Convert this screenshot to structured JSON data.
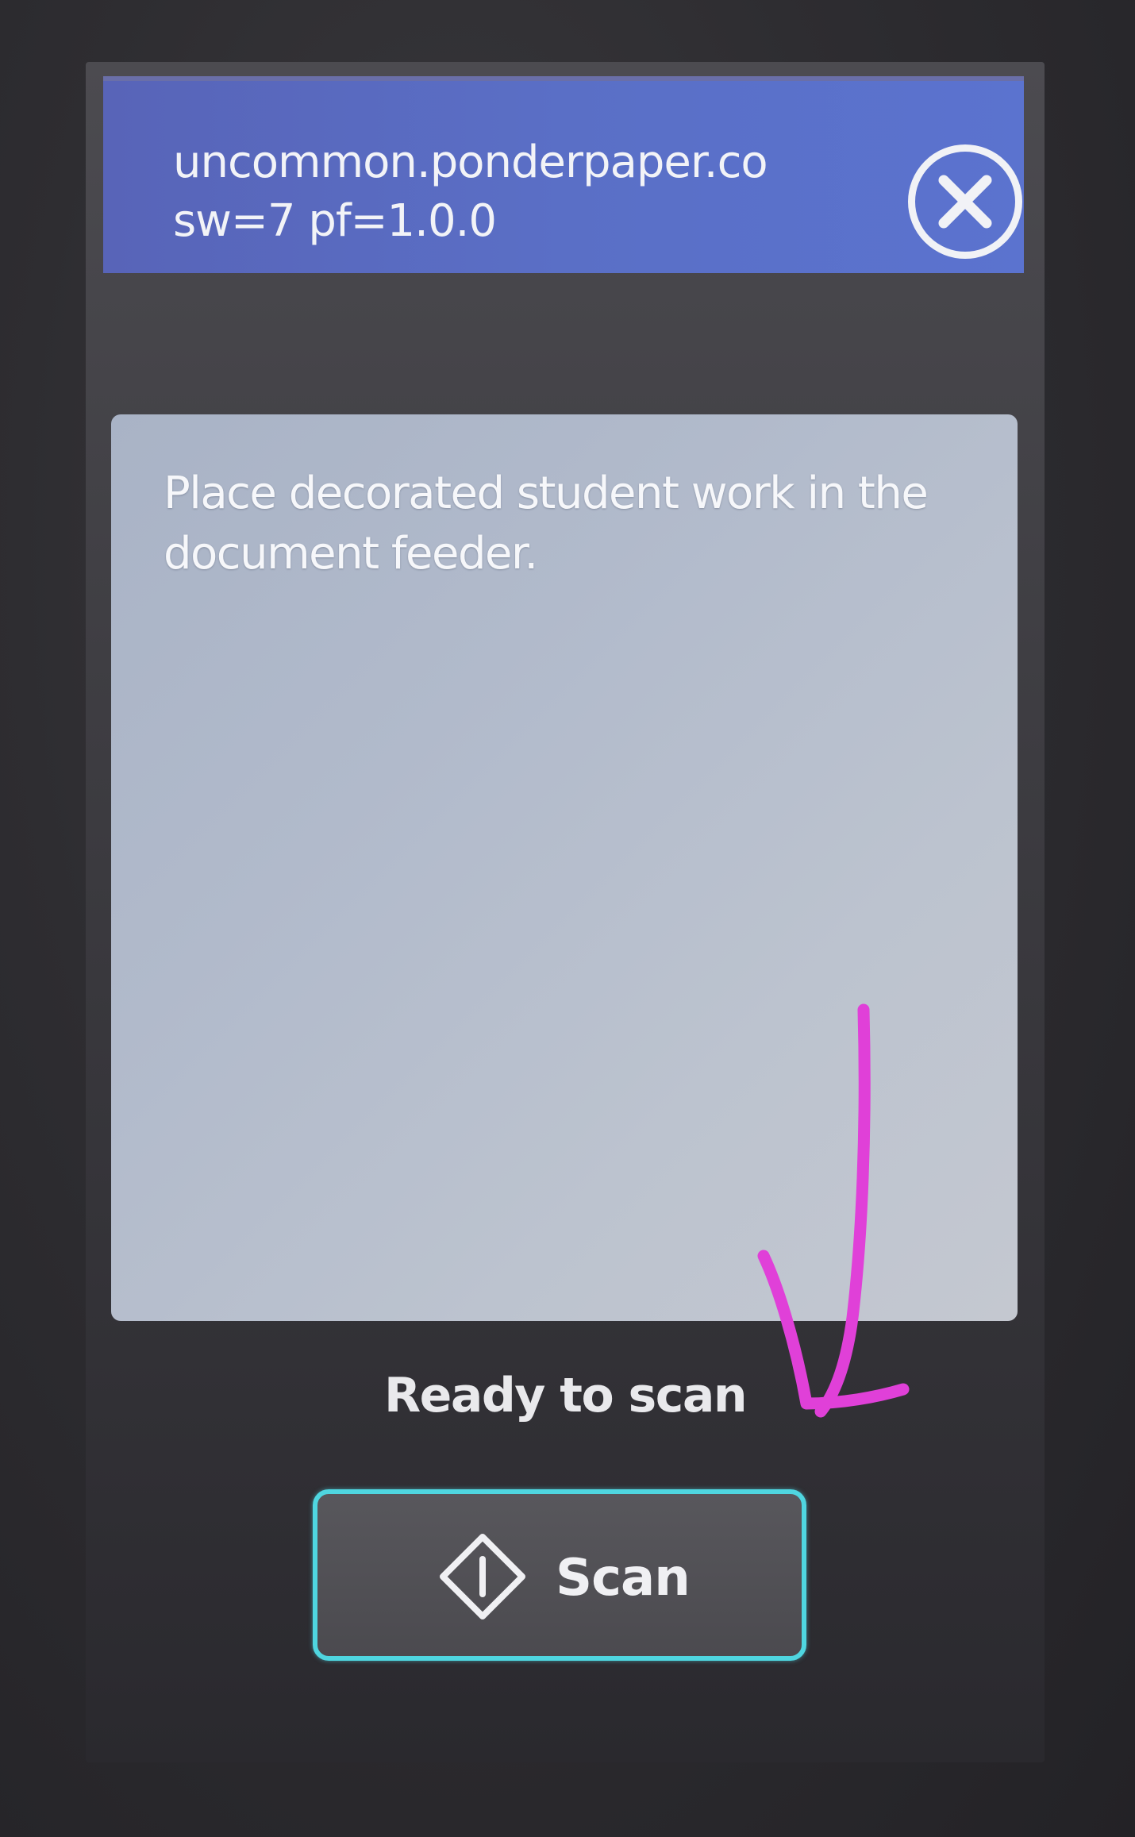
{
  "header": {
    "title_line1": "uncommon.ponderpaper.co",
    "title_line2": "sw=7 pf=1.0.0",
    "close_icon": "close-circle-x"
  },
  "message": {
    "text": "Place decorated student work in the document feeder."
  },
  "status": {
    "text": "Ready to scan"
  },
  "scan_button": {
    "label": "Scan",
    "icon": "diamond-start-icon"
  },
  "colors": {
    "header_bg": "#5a6fc6",
    "panel_bg": "#b4bccb",
    "button_border": "#4fd6e0",
    "annotation": "#e040d8"
  }
}
